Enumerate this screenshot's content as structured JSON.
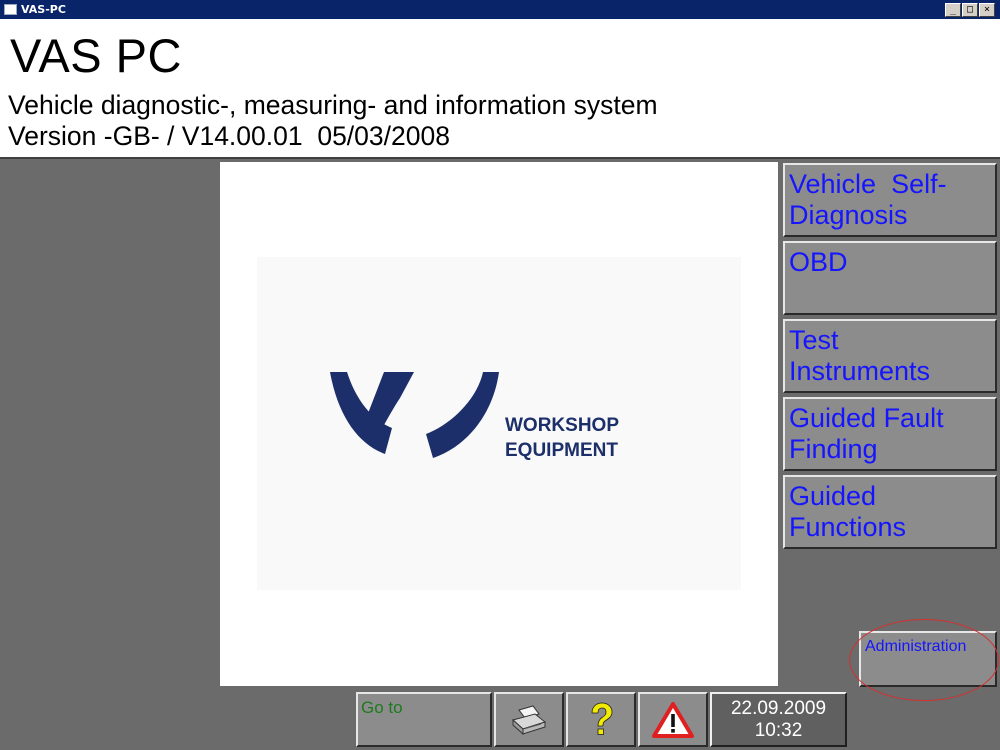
{
  "window": {
    "title": "VAS-PC",
    "controls": {
      "minimize": "_",
      "maximize": "□",
      "close": "×"
    }
  },
  "header": {
    "app_title": "VAS PC",
    "subtitle": "Vehicle diagnostic-, measuring- and information system",
    "version": "Version -GB- / V14.00.01  05/03/2008"
  },
  "logo": {
    "line1": "WORKSHOP",
    "line2": "EQUIPMENT",
    "brand_color": "#1c2f6a"
  },
  "side_menu": {
    "items": [
      {
        "label_lines": [
          "Vehicle  Self-",
          "Diagnosis"
        ]
      },
      {
        "label_lines": [
          "OBD",
          ""
        ]
      },
      {
        "label_lines": [
          "Test",
          "Instruments"
        ]
      },
      {
        "label_lines": [
          "Guided Fault",
          "Finding"
        ]
      },
      {
        "label_lines": [
          "Guided",
          "Functions"
        ]
      }
    ],
    "administration_label": "Administration",
    "label_color": "#1515ff"
  },
  "toolbar": {
    "goto_label": "Go to",
    "print_icon": "printer-icon",
    "help_icon": "question-mark-icon",
    "warning_icon": "warning-triangle-icon",
    "date": "22.09.2009",
    "time": "10:32"
  },
  "colors": {
    "titlebar": "#0a246a",
    "background": "#6b6b6b",
    "button_face": "#8c8c8c",
    "help_yellow": "#f2ea00",
    "warning_red": "#e02020",
    "goto_green": "#1e7a1e"
  }
}
